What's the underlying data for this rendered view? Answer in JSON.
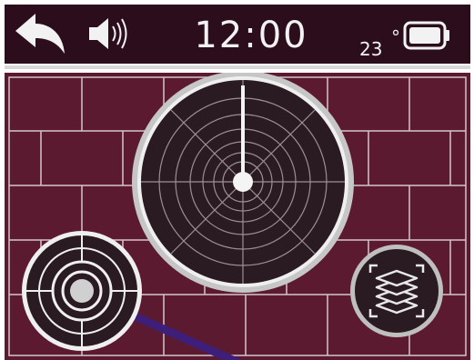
{
  "status_bar": {
    "clock": "12:00",
    "temperature_value": "23",
    "temperature_unit": "°",
    "battery_level": 1.0,
    "icons": [
      "back-arrow-icon",
      "speaker-icon",
      "battery-icon"
    ]
  },
  "colors": {
    "topbar_background": "#2c0d1b",
    "field_background": "#5c1a30",
    "grid_lines": "#d4c4ca",
    "radar_line": "#e8e8e8",
    "trace_line": "#3d1f7a"
  },
  "main": {
    "radar_icon": "radar-icon",
    "target_icon": "target-icon",
    "layers_icon": "layers-icon"
  }
}
